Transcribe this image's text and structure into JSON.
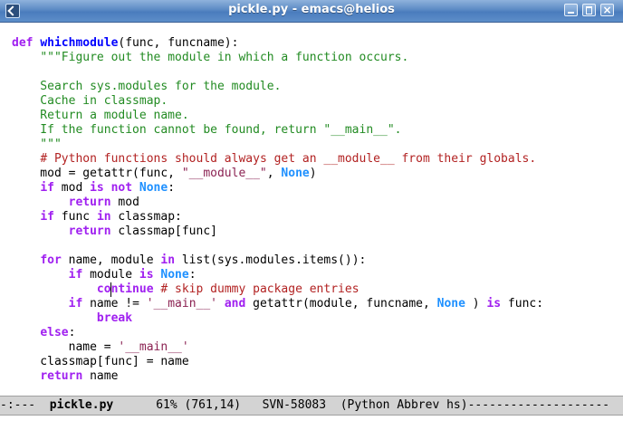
{
  "window": {
    "title": "pickle.py - emacs@helios"
  },
  "code_lines": [
    [
      [
        "kw",
        "def "
      ],
      [
        "fn",
        "whichmodule"
      ],
      [
        "",
        "(func, funcname):"
      ]
    ],
    [
      [
        "",
        "    "
      ],
      [
        "doc",
        "\"\"\"Figure out the module in which a function occurs."
      ]
    ],
    [],
    [
      [
        "doc",
        "    Search sys.modules for the module."
      ]
    ],
    [
      [
        "doc",
        "    Cache in classmap."
      ]
    ],
    [
      [
        "doc",
        "    Return a module name."
      ]
    ],
    [
      [
        "doc",
        "    If the function cannot be found, return \"__main__\"."
      ]
    ],
    [
      [
        "doc",
        "    \"\"\""
      ]
    ],
    [
      [
        "",
        "    "
      ],
      [
        "cmt",
        "# Python functions should always get an __module__ from their globals."
      ]
    ],
    [
      [
        "",
        "    mod = getattr(func, "
      ],
      [
        "str",
        "\"__module__\""
      ],
      [
        "",
        ", "
      ],
      [
        "const",
        "None"
      ],
      [
        "",
        ")"
      ]
    ],
    [
      [
        "",
        "    "
      ],
      [
        "kw",
        "if"
      ],
      [
        "",
        " mod "
      ],
      [
        "kw",
        "is not"
      ],
      [
        "",
        " "
      ],
      [
        "const",
        "None"
      ],
      [
        "",
        ":"
      ]
    ],
    [
      [
        "",
        "        "
      ],
      [
        "kw",
        "return"
      ],
      [
        "",
        " mod"
      ]
    ],
    [
      [
        "",
        "    "
      ],
      [
        "kw",
        "if"
      ],
      [
        "",
        " func "
      ],
      [
        "kw",
        "in"
      ],
      [
        "",
        " classmap:"
      ]
    ],
    [
      [
        "",
        "        "
      ],
      [
        "kw",
        "return"
      ],
      [
        "",
        " classmap[func]"
      ]
    ],
    [],
    [
      [
        "",
        "    "
      ],
      [
        "kw",
        "for"
      ],
      [
        "",
        " name, module "
      ],
      [
        "kw",
        "in"
      ],
      [
        "",
        " list(sys.modules.items()):"
      ]
    ],
    [
      [
        "",
        "        "
      ],
      [
        "kw",
        "if"
      ],
      [
        "",
        " module "
      ],
      [
        "kw",
        "is"
      ],
      [
        "",
        " "
      ],
      [
        "const",
        "None"
      ],
      [
        "",
        ":"
      ]
    ],
    [
      [
        "",
        "            "
      ],
      [
        "kw",
        "co"
      ],
      [
        "cursor",
        ""
      ],
      [
        "kw",
        "ntinue"
      ],
      [
        "",
        " "
      ],
      [
        "cmt",
        "# skip dummy package entries"
      ]
    ],
    [
      [
        "",
        "        "
      ],
      [
        "kw",
        "if"
      ],
      [
        "",
        " name != "
      ],
      [
        "str",
        "'__main__'"
      ],
      [
        "",
        " "
      ],
      [
        "kw",
        "and"
      ],
      [
        "",
        " getattr(module, funcname, "
      ],
      [
        "const",
        "None"
      ],
      [
        "",
        " ) "
      ],
      [
        "kw",
        "is"
      ],
      [
        "",
        " func:"
      ]
    ],
    [
      [
        "",
        "            "
      ],
      [
        "kw",
        "break"
      ]
    ],
    [
      [
        "",
        "    "
      ],
      [
        "kw",
        "else"
      ],
      [
        "",
        ":"
      ]
    ],
    [
      [
        "",
        "        name = "
      ],
      [
        "str",
        "'__main__'"
      ]
    ],
    [
      [
        "",
        "    classmap[func] = name"
      ]
    ],
    [
      [
        "",
        "    "
      ],
      [
        "kw",
        "return"
      ],
      [
        "",
        " name"
      ]
    ]
  ],
  "modeline": {
    "prefix": "-:---  ",
    "buffer_name": "pickle.py",
    "position": "      61% (761,14)   SVN-58083  (Python Abbrev hs)",
    "fill": "--------------------"
  },
  "colors": {
    "keyword": "#a020f0",
    "function_name": "#0000ff",
    "string": "#8b2252",
    "docstring": "#228b22",
    "comment": "#b22222",
    "constant": "#1e90ff",
    "modeline_bg": "#d3d3d3",
    "titlebar": "#5b8ac4"
  },
  "icons": {
    "app": "emacs-icon",
    "minimize": "minimize-icon",
    "maximize": "maximize-icon",
    "close": "close-icon"
  }
}
